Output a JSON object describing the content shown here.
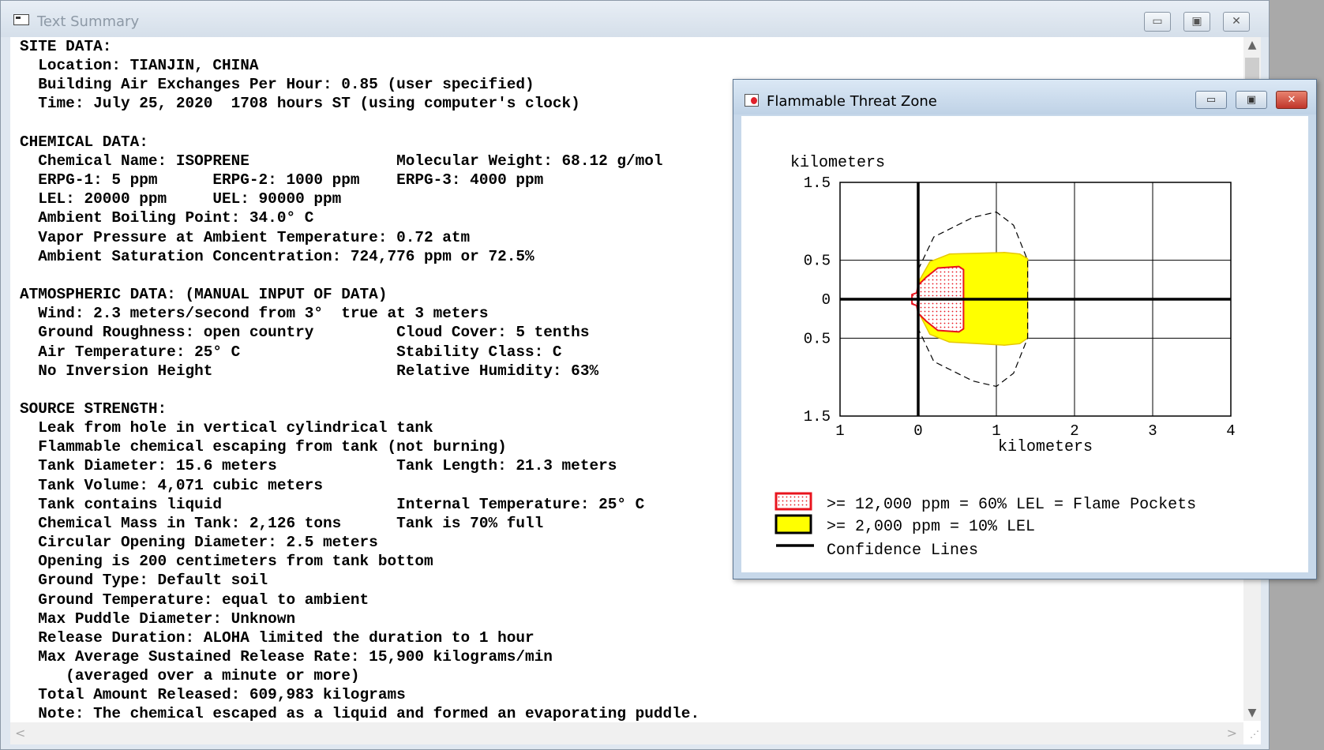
{
  "main_window": {
    "title": "Text Summary",
    "buttons": {
      "minimize": "▭",
      "maximize": "▣",
      "close": "✕"
    },
    "summary_lines": [
      "SITE DATA:",
      "  Location: TIANJIN, CHINA",
      "  Building Air Exchanges Per Hour: 0.85 (user specified)",
      "  Time: July 25, 2020  1708 hours ST (using computer's clock)",
      "",
      "CHEMICAL DATA:",
      "  Chemical Name: ISOPRENE                Molecular Weight: 68.12 g/mol",
      "  ERPG-1: 5 ppm      ERPG-2: 1000 ppm    ERPG-3: 4000 ppm",
      "  LEL: 20000 ppm     UEL: 90000 ppm",
      "  Ambient Boiling Point: 34.0° C",
      "  Vapor Pressure at Ambient Temperature: 0.72 atm",
      "  Ambient Saturation Concentration: 724,776 ppm or 72.5%",
      "",
      "ATMOSPHERIC DATA: (MANUAL INPUT OF DATA)",
      "  Wind: 2.3 meters/second from 3°  true at 3 meters",
      "  Ground Roughness: open country         Cloud Cover: 5 tenths",
      "  Air Temperature: 25° C                 Stability Class: C",
      "  No Inversion Height                    Relative Humidity: 63%",
      "",
      "SOURCE STRENGTH:",
      "  Leak from hole in vertical cylindrical tank",
      "  Flammable chemical escaping from tank (not burning)",
      "  Tank Diameter: 15.6 meters             Tank Length: 21.3 meters",
      "  Tank Volume: 4,071 cubic meters",
      "  Tank contains liquid                   Internal Temperature: 25° C",
      "  Chemical Mass in Tank: 2,126 tons      Tank is 70% full",
      "  Circular Opening Diameter: 2.5 meters",
      "  Opening is 200 centimeters from tank bottom",
      "  Ground Type: Default soil",
      "  Ground Temperature: equal to ambient",
      "  Max Puddle Diameter: Unknown",
      "  Release Duration: ALOHA limited the duration to 1 hour",
      "  Max Average Sustained Release Rate: 15,900 kilograms/min",
      "     (averaged over a minute or more)",
      "  Total Amount Released: 609,983 kilograms",
      "  Note: The chemical escaped as a liquid and formed an evaporating puddle."
    ],
    "scroll": {
      "up": "▲",
      "down": "▼",
      "left": "<",
      "right": ">"
    }
  },
  "threat_window": {
    "title": "Flammable Threat Zone",
    "buttons": {
      "minimize": "▭",
      "maximize": "▣",
      "close": "✕"
    }
  },
  "chart_data": {
    "type": "area",
    "xlabel": "kilometers",
    "ylabel": "kilometers",
    "xlim": [
      -1,
      4
    ],
    "ylim": [
      -1.5,
      1.5
    ],
    "x_ticks": [
      -1,
      0,
      1,
      2,
      3,
      4
    ],
    "x_tick_labels": [
      "1",
      "0",
      "1",
      "2",
      "3",
      "4"
    ],
    "y_ticks": [
      1.5,
      0.5,
      0,
      -0.5,
      -1.5
    ],
    "y_tick_labels": [
      "1.5",
      "0.5",
      "0",
      "0.5",
      "1.5"
    ],
    "grid": true,
    "zones": [
      {
        "name": ">= 12,000 ppm = 60% LEL = Flame Pockets",
        "color": "#e8141e",
        "fill": "dotted-red",
        "outline": [
          [
            0,
            0.18
          ],
          [
            0.1,
            0.28
          ],
          [
            0.25,
            0.4
          ],
          [
            0.52,
            0.42
          ],
          [
            0.58,
            0.38
          ],
          [
            0.58,
            -0.38
          ],
          [
            0.52,
            -0.42
          ],
          [
            0.25,
            -0.4
          ],
          [
            0.1,
            -0.28
          ],
          [
            0,
            -0.18
          ],
          [
            -0.02,
            -0.08
          ],
          [
            -0.08,
            -0.06
          ],
          [
            -0.08,
            0.06
          ],
          [
            -0.02,
            0.08
          ]
        ]
      },
      {
        "name": ">= 2,000 ppm = 10% LEL",
        "color": "#ffff00",
        "fill": "solid-yellow",
        "outline": [
          [
            0.02,
            0.25
          ],
          [
            0.15,
            0.48
          ],
          [
            0.4,
            0.58
          ],
          [
            1.1,
            0.6
          ],
          [
            1.3,
            0.58
          ],
          [
            1.4,
            0.52
          ],
          [
            1.4,
            -0.5
          ],
          [
            1.3,
            -0.57
          ],
          [
            1.1,
            -0.59
          ],
          [
            0.4,
            -0.55
          ],
          [
            0.15,
            -0.45
          ],
          [
            0.02,
            -0.2
          ]
        ]
      },
      {
        "name": "Confidence Lines",
        "color": "#000000",
        "fill": "dashed",
        "outline": [
          [
            0,
            0.38
          ],
          [
            0.2,
            0.8
          ],
          [
            0.7,
            1.05
          ],
          [
            1,
            1.12
          ],
          [
            1.22,
            0.95
          ],
          [
            1.4,
            0.5
          ],
          [
            1.4,
            -0.5
          ],
          [
            1.22,
            -0.95
          ],
          [
            1,
            -1.12
          ],
          [
            0.7,
            -1.05
          ],
          [
            0.2,
            -0.8
          ],
          [
            0,
            -0.38
          ]
        ]
      }
    ],
    "legend": [
      {
        "label": ">= 12,000 ppm = 60% LEL = Flame Pockets",
        "swatch": "red-dotted"
      },
      {
        "label": ">= 2,000 ppm = 10% LEL",
        "swatch": "yellow"
      },
      {
        "label": "Confidence Lines",
        "swatch": "line"
      }
    ]
  }
}
